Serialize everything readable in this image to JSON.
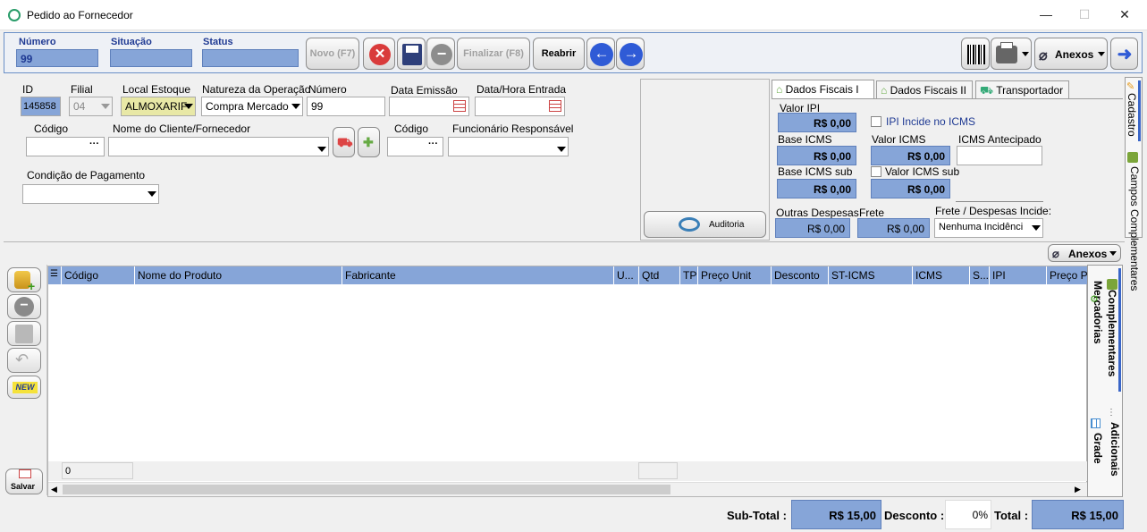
{
  "window": {
    "title": "Pedido ao Fornecedor",
    "minimize": "—",
    "maximize": "☐",
    "close": "✕"
  },
  "toolbar": {
    "numero_label": "Número",
    "numero_value": "99",
    "situacao_label": "Situação",
    "situacao_value": "",
    "status_label": "Status",
    "status_value": "",
    "novo": "Novo (F7)",
    "finalizar": "Finalizar (F8)",
    "reabrir": "Reabrir",
    "anexos": "Anexos"
  },
  "form": {
    "id_label": "ID",
    "id_value": "145858",
    "filial_label": "Filial",
    "filial_value": "04",
    "local_label": "Local Estoque",
    "local_value": "ALMOXARIF",
    "natureza_label": "Natureza da Operação",
    "natureza_value": "Compra Mercado",
    "numero_label": "Número",
    "numero_value": "99",
    "emissao_label": "Data Emissão",
    "emissao_value": "",
    "entrada_label": "Data/Hora Entrada",
    "entrada_value": "",
    "codigo_label": "Código",
    "codigo_value": "",
    "cliente_label": "Nome do Cliente/Fornecedor",
    "cliente_value": "",
    "codigo2_label": "Código",
    "codigo2_value": "",
    "funcionario_label": "Funcionário Responsável",
    "funcionario_value": "",
    "condicao_label": "Condição de Pagamento",
    "condicao_value": "",
    "auditoria": "Auditoria"
  },
  "fiscal": {
    "tabs": [
      "Dados Fiscais I",
      "Dados Fiscais II",
      "Transportador"
    ],
    "valor_ipi_label": "Valor IPI",
    "valor_ipi": "R$ 0,00",
    "ipi_incide": "IPI Incide no ICMS",
    "base_icms_label": "Base ICMS",
    "base_icms": "R$ 0,00",
    "valor_icms_label": "Valor ICMS",
    "valor_icms": "R$ 0,00",
    "icms_antecipado_label": "ICMS Antecipado",
    "icms_antecipado": "",
    "base_icms_sub_label": "Base ICMS sub",
    "base_icms_sub": "R$ 0,00",
    "valor_icms_sub_label": "Valor ICMS sub",
    "valor_icms_sub": "R$ 0,00",
    "outras_label": "Outras Despesas",
    "outras": "R$ 0,00",
    "frete_label": "Frete",
    "frete": "R$ 0,00",
    "frete_incide_label": "Frete / Despesas Incide:",
    "frete_incide": "Nenhuma Incidênci"
  },
  "side_tabs": {
    "cadastro": "Cadastro",
    "campos": "Campos Complementares"
  },
  "grid": {
    "anexos": "Anexos",
    "columns": [
      "Código",
      "Nome do Produto",
      "Fabricante",
      "U...",
      "Qtd",
      "TP",
      "Preço Unit",
      "Desconto",
      "ST-ICMS",
      "ICMS",
      "S...",
      "IPI",
      "Preço Pa"
    ],
    "footer_count": "0",
    "side_tabs": [
      "Mercadorias",
      "Complementares",
      "Grade",
      "Adicionais"
    ],
    "new_label": "NEW",
    "salvar": "Salvar"
  },
  "totals": {
    "subtotal_label": "Sub-Total :",
    "subtotal": "R$ 15,00",
    "desconto_label": "Desconto :",
    "desconto": "0%",
    "total_label": "Total :",
    "total": "R$ 15,00"
  },
  "colors": {
    "accent": "#86a5d8",
    "dark_accent": "#1f3a93",
    "nav_blue": "#2f5bd6"
  }
}
